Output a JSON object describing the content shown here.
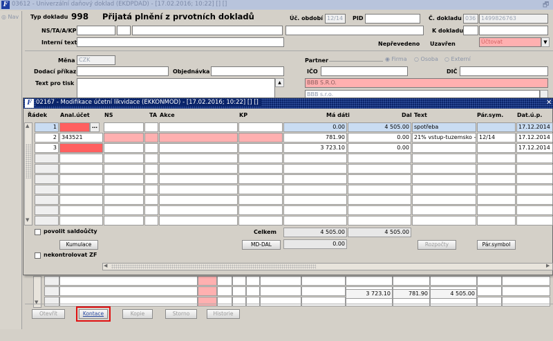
{
  "main": {
    "title": "03612 - Univerzální daňový doklad (EKDPDAD) - [17.02.2016; 10:22] [] []",
    "restore_glyph": "🗗",
    "nav_label": "Nav",
    "typ_label": "Typ dokladu",
    "typ_value": "998",
    "doc_title": "Přijatá plnění z prvotních dokladů",
    "uc_obdobi_label": "Úč. období",
    "uc_obdobi_value": "12/14",
    "pid_label": "PID",
    "c_dokladu_label": "Č. dokladu",
    "c_dokladu_prefix": "036",
    "c_dokladu_value": "1499826763",
    "ns_label": "NS/TA/A/KP",
    "k_dokladu_label": "K dokladu",
    "interni_label": "Interní text",
    "neprevedeno_label": "Nepřevedeno",
    "uzavren_label": "Uzavřen",
    "uzavren_value": "Účtovat",
    "mena_label": "Měna",
    "mena_value": "CZK",
    "partner_label": "Partner",
    "partner_options": [
      "Firma",
      "Osoba",
      "Externí"
    ],
    "dodaci_label": "Dodací příkaz",
    "objednavka_label": "Objednávka",
    "ico_label": "IČO",
    "dic_label": "DIČ",
    "text_tisk_label": "Text pro tisk",
    "partner_name": "BBB S.R.O.",
    "partner_name2": "BBB s.r.o.",
    "bottom_totals": [
      "3 723.10",
      "781.90",
      "4 505.00"
    ],
    "buttons": {
      "otevrit": "Otevřít",
      "kontace": "Kontace",
      "kopie": "Kopie",
      "storno": "Storno",
      "historie": "Historie"
    }
  },
  "dialog": {
    "title": "02167 - Modifikace účetní likvidace (EKKONMOD) - [17.02.2016; 10:22] [] []",
    "close_glyph": "✕",
    "columns": {
      "radek": "Řádek",
      "anal": "Anal.účet",
      "ns": "NS",
      "ta": "TA",
      "akce": "Akce",
      "kp": "KP",
      "ma_dati": "Má dáti",
      "dal": "Dal",
      "text": "Text",
      "par_sym": "Pár.sym.",
      "dat_up": "Dat.ú.p."
    },
    "rows": [
      {
        "radek": "1",
        "anal": "",
        "ns": "",
        "ta": "",
        "akce": "",
        "kp": "",
        "ma_dati": "0.00",
        "dal": "4 505.00",
        "text": "spotřeba",
        "par_sym": "",
        "dat_up": "17.12.2014"
      },
      {
        "radek": "2",
        "anal": "343521",
        "ns": "",
        "ta": "",
        "akce": "",
        "kp": "",
        "ma_dati": "781.90",
        "dal": "0.00",
        "text": "21% vstup-tuzemsko -",
        "par_sym": "12/14",
        "dat_up": "17.12.2014"
      },
      {
        "radek": "3",
        "anal": "",
        "ns": "",
        "ta": "",
        "akce": "",
        "kp": "",
        "ma_dati": "3 723.10",
        "dal": "0.00",
        "text": "",
        "par_sym": "",
        "dat_up": "17.12.2014"
      }
    ],
    "povolit_label": "povolit saldoůčty",
    "celkem_label": "Celkem",
    "celkem_ma_dati": "4 505.00",
    "celkem_dal": "4 505.00",
    "kumulace_button": "Kumulace",
    "md_dal_button": "MD-DAL",
    "md_dal_value": "0.00",
    "rozpocty_button": "Rozpočty",
    "par_symbol_button": "Pár.symbol",
    "nekontrolovat_label": "nekontrolovat ZF"
  }
}
